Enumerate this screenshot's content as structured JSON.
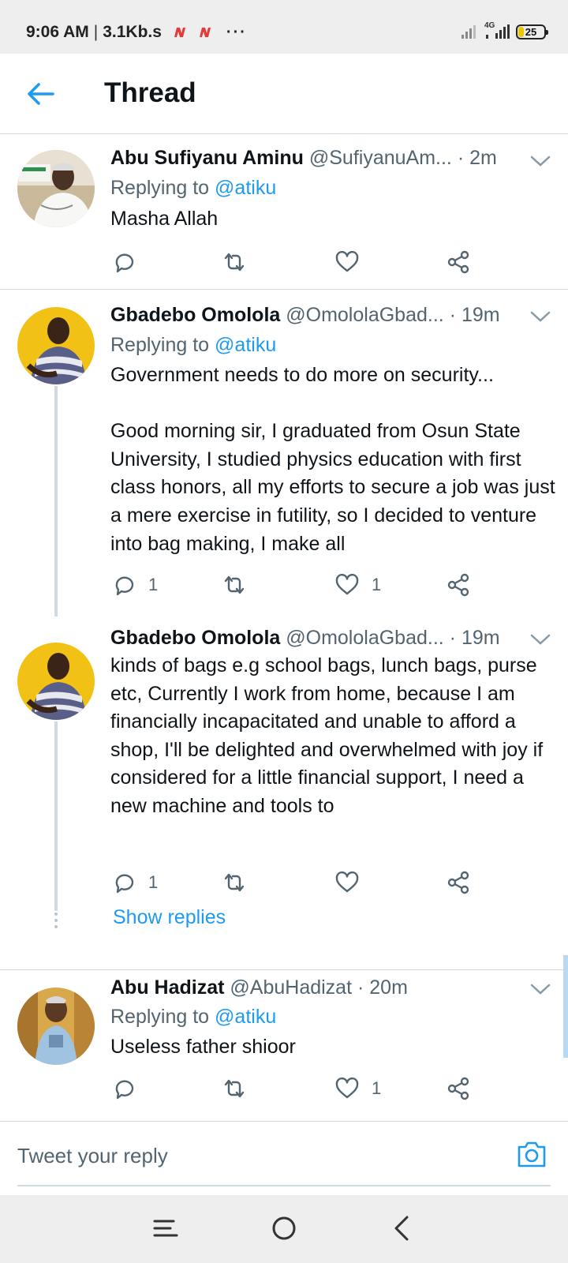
{
  "status_bar": {
    "time": "9:06 AM",
    "speed": "3.1Kb.s",
    "network": "4G",
    "battery": "25",
    "colors": {
      "notif": "#e53935"
    }
  },
  "header": {
    "title": "Thread",
    "back_icon": "arrow-left-icon"
  },
  "tweets": [
    {
      "name": "Abu Sufiyanu Aminu",
      "handle": "@SufiyanuAm...",
      "time": "· 2m",
      "replying_prefix": "Replying to ",
      "replying_to": "@atiku",
      "text": "Masha Allah",
      "reply_count": "",
      "retweet_count": "",
      "like_count": ""
    },
    {
      "name": "Gbadebo Omolola",
      "handle": "@OmololaGbad...",
      "time": "· 19m",
      "replying_prefix": "Replying to ",
      "replying_to": "@atiku",
      "text": "Government needs to do more on security...\n\nGood morning sir, I graduated from Osun State University, I studied physics education with first class honors, all my efforts to secure a job was just a mere exercise in futility, so I decided to venture into bag making, I make all",
      "reply_count": "1",
      "retweet_count": "",
      "like_count": "1"
    },
    {
      "name": "Gbadebo Omolola",
      "handle": "@OmololaGbad...",
      "time": "· 19m",
      "text": "kinds of bags e.g school bags, lunch bags, purse etc, Currently I work from home, because I am financially incapacitated and unable to afford a shop, I'll be delighted and overwhelmed with joy if considered for a little financial support, I need a new machine and tools to",
      "reply_count": "1",
      "retweet_count": "",
      "like_count": ""
    },
    {
      "name": "Abu Hadizat",
      "handle": "@AbuHadizat",
      "time": "· 20m",
      "replying_prefix": "Replying to ",
      "replying_to": "@atiku",
      "text": "Useless father shioor",
      "reply_count": "",
      "retweet_count": "",
      "like_count": "1"
    }
  ],
  "show_replies": "Show replies",
  "reply_bar": {
    "placeholder": "Tweet your reply",
    "camera_icon": "camera-icon"
  },
  "colors": {
    "accent": "#1d9bf0",
    "muted": "#536471",
    "text": "#0f1419",
    "divider": "#cfd9de"
  }
}
